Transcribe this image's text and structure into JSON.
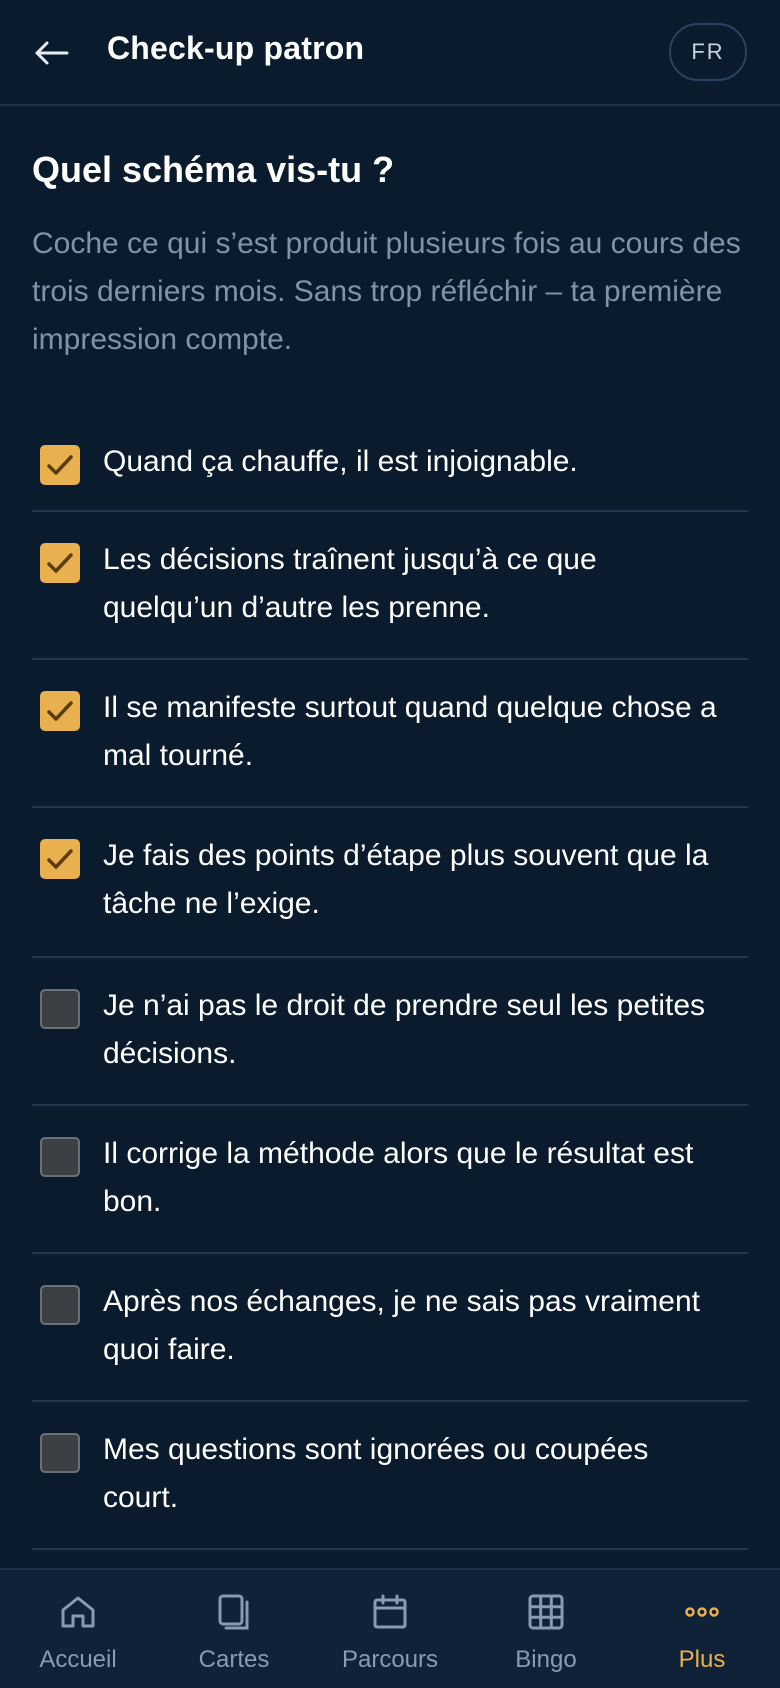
{
  "header": {
    "back_icon": "arrow-left-icon",
    "title": "Check-up patron",
    "lang": "FR"
  },
  "main": {
    "title": "Quel schéma vis-tu ?",
    "intro": "Coche ce qui s’est produit plusieurs fois au cours des trois derniers mois. Sans trop réfléchir – ta première impression compte.",
    "items": [
      {
        "label": "Quand ça chauffe, il est injoignable.",
        "checked": true
      },
      {
        "label": "Les décisions traînent jusqu’à ce que quelqu’un d’autre les prenne.",
        "checked": true
      },
      {
        "label": "Il se manifeste surtout quand quelque chose a mal tourné.",
        "checked": true
      },
      {
        "label": "Je fais des points d’étape plus souvent que la tâche ne l’exige.",
        "checked": true
      },
      {
        "label": "Je n’ai pas le droit de prendre seul les petites décisions.",
        "checked": false
      },
      {
        "label": "Il corrige la méthode alors que le résultat est bon.",
        "checked": false
      },
      {
        "label": "Après nos échanges, je ne sais pas vraiment quoi faire.",
        "checked": false
      },
      {
        "label": "Mes questions sont ignorées ou coupées court.",
        "checked": false
      }
    ]
  },
  "nav": {
    "items": [
      {
        "label": "Accueil",
        "icon": "home-icon"
      },
      {
        "label": "Cartes",
        "icon": "cards-icon"
      },
      {
        "label": "Parcours",
        "icon": "calendar-icon"
      },
      {
        "label": "Bingo",
        "icon": "grid-icon"
      },
      {
        "label": "Plus",
        "icon": "more-icon",
        "active": true
      }
    ]
  },
  "colors": {
    "background": "#0a1b2e",
    "accent": "#e8b04e",
    "muted_text": "#7f93ab",
    "divider": "#22364d"
  }
}
